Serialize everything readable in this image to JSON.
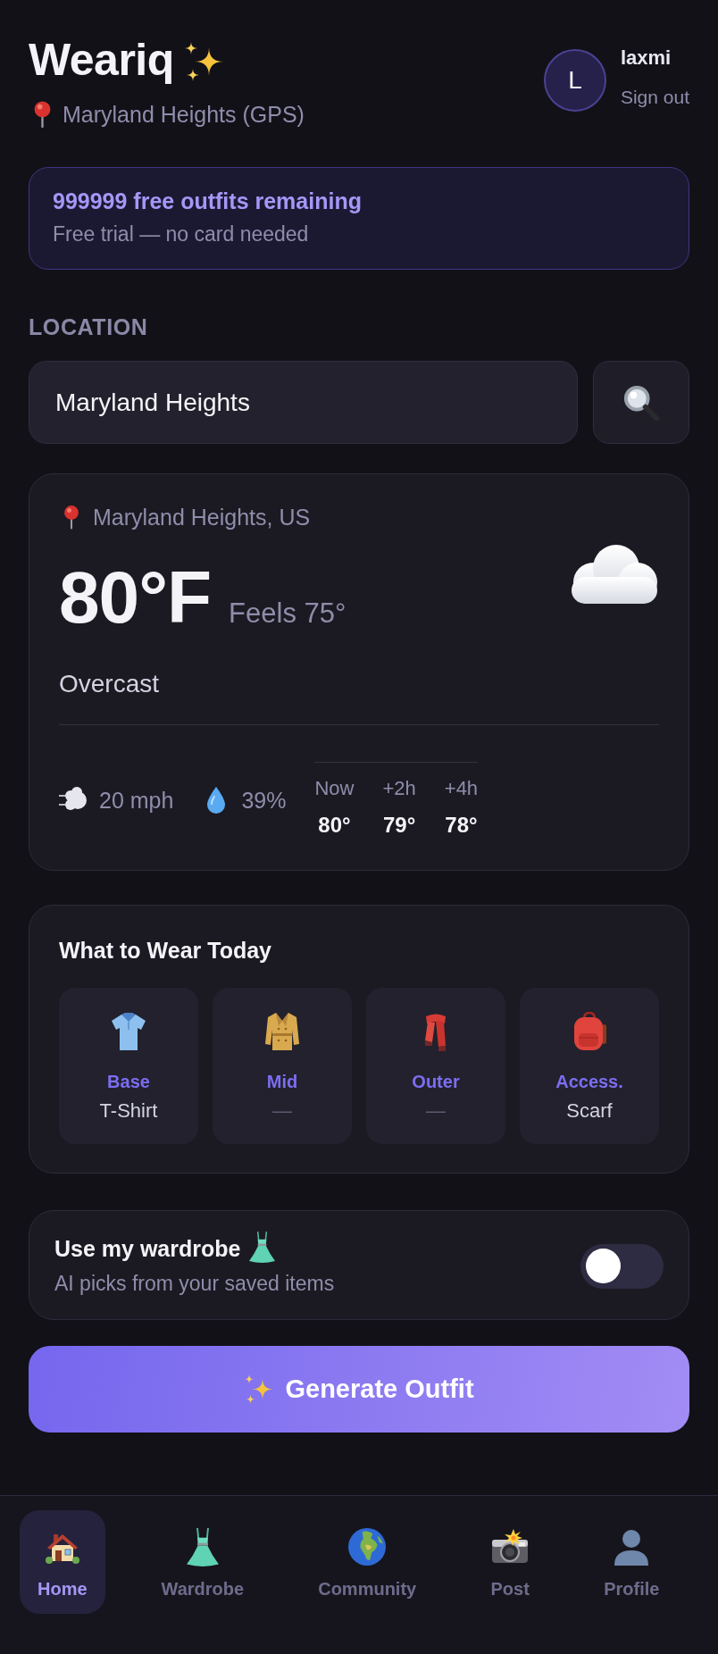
{
  "header": {
    "title": "Weariq",
    "location": "Maryland Heights (GPS)",
    "user": {
      "initial": "L",
      "name": "laxmi",
      "sign_out": "Sign out"
    }
  },
  "banner": {
    "title": "999999 free outfits remaining",
    "subtitle": "Free trial — no card needed"
  },
  "location": {
    "label": "LOCATION",
    "value": "Maryland Heights"
  },
  "weather": {
    "place": "Maryland Heights, US",
    "temperature": "80°F",
    "feels_like": "Feels 75°",
    "condition": "Overcast",
    "wind": "20 mph",
    "humidity": "39%",
    "forecast": [
      {
        "time": "Now",
        "temp": "80°"
      },
      {
        "time": "+2h",
        "temp": "79°"
      },
      {
        "time": "+4h",
        "temp": "78°"
      }
    ]
  },
  "outfit": {
    "title": "What to Wear Today",
    "layers": [
      {
        "label": "Base",
        "value": "T-Shirt",
        "empty": false
      },
      {
        "label": "Mid",
        "value": "—",
        "empty": true
      },
      {
        "label": "Outer",
        "value": "—",
        "empty": true
      },
      {
        "label": "Access.",
        "value": "Scarf",
        "empty": false
      }
    ]
  },
  "wardrobe": {
    "title": "Use my wardrobe",
    "subtitle": "AI picks from your saved items",
    "on": false
  },
  "generate_button": {
    "label": "Generate Outfit"
  },
  "nav": [
    {
      "label": "Home",
      "selected": true
    },
    {
      "label": "Wardrobe",
      "selected": false
    },
    {
      "label": "Community",
      "selected": false
    },
    {
      "label": "Post",
      "selected": false
    },
    {
      "label": "Profile",
      "selected": false
    }
  ]
}
